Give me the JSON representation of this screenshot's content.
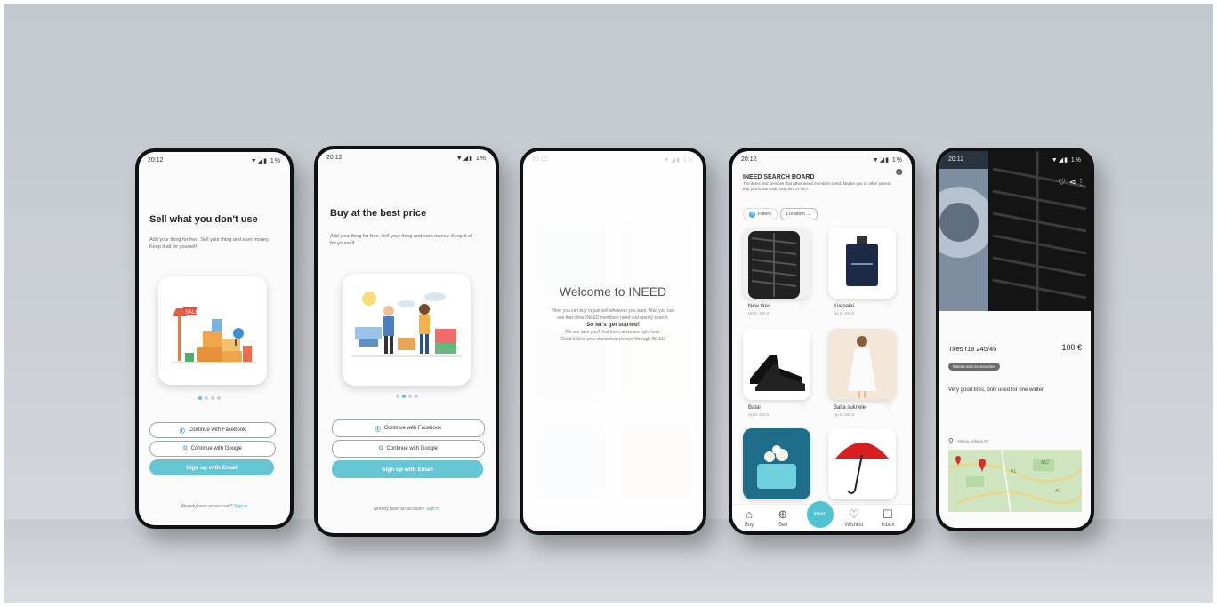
{
  "status": {
    "time": "20:12",
    "icons": "▼◢▮ 1%"
  },
  "screen1": {
    "title": "Sell what you don't use",
    "desc": "Add your thing for free. Sell your thing and earn money. Keep it all for yourself",
    "btn_facebook": "Continue with Facebook",
    "btn_google": "Continue with Google",
    "btn_email": "Sign up with Email",
    "footer": "Already have an account?",
    "footer_link": "Sign in",
    "illustration_badge": "SALE"
  },
  "screen2": {
    "title": "Buy at the best price",
    "desc": "Add your thing for free. Sell your thing and earn money. Keep it all for yourself",
    "btn_facebook": "Continue with Facebook",
    "btn_google": "Continue with Google",
    "btn_email": "Sign up with Email",
    "footer": "Already have an account?",
    "footer_link": "Sign in"
  },
  "screen3": {
    "welcome": "Welcome to INEED",
    "line1": "Here you can buy or just sell whatever you want. Also you can",
    "line2": "see that other INEED members need and openly search.",
    "cta": "So let's get started!",
    "line3": "We are sure you'll find them at we are right here.",
    "line4": "Good luck in your wanderlust journey through INEED"
  },
  "screen4": {
    "header": "INEED SEARCH BOARD",
    "subheader": "The items and services that other ineed members need. Maybe you or other person that you know could help him or her?",
    "filter": "Filters",
    "location": "Location",
    "items": [
      {
        "name": "New tires",
        "sub": "Up to 100 €"
      },
      {
        "name": "Kvepalai",
        "sub": "Up to 100 €"
      },
      {
        "name": "Batai",
        "sub": "Up to 100 €"
      },
      {
        "name": "Balta suknele",
        "sub": "Up to 100 €"
      }
    ],
    "nav": [
      "Buy",
      "Sell",
      "ineed",
      "Wishlist",
      "Inbox"
    ]
  },
  "screen5": {
    "item_title": "Tires r18 245/45",
    "price": "100 €",
    "tag": "Motors and Accessories",
    "description": "Very good tires, only used for one winter",
    "location": "Vilnius, Vilnius 37",
    "map_labels": [
      "A12",
      "A1",
      "A2"
    ]
  },
  "colors": {
    "accent": "#66c6d3",
    "heart_red": "#e02b2b",
    "umbrella": "#d81e1e"
  }
}
